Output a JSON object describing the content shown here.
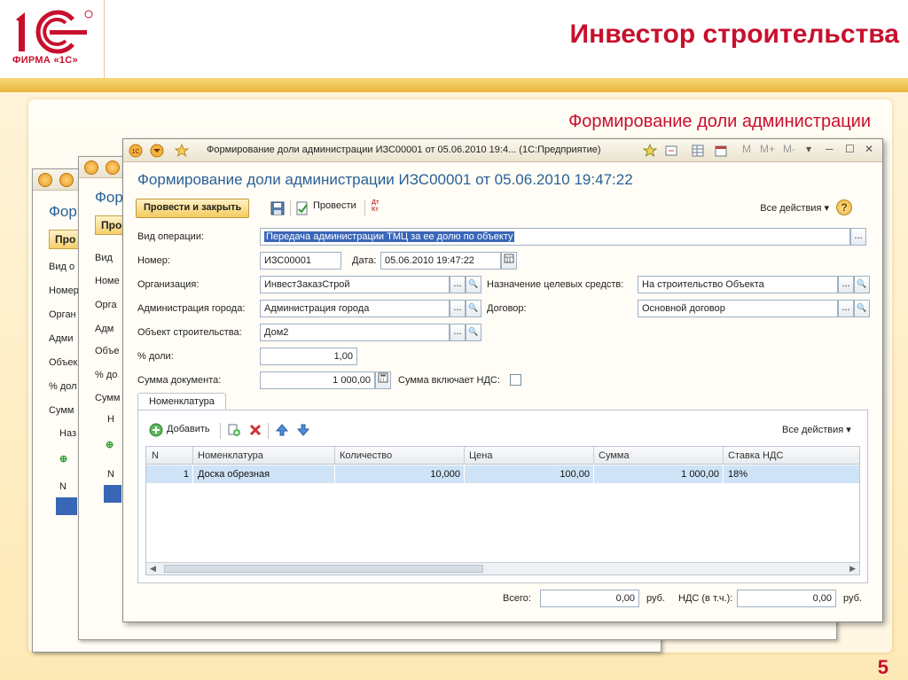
{
  "slide": {
    "title": "Инвестор строительства",
    "subtitle": "Формирование доли администрации",
    "page_number": "5",
    "logo_text": "ФИРМА «1С»",
    "logo_mark": "1С",
    "brand_color": "#c8102e"
  },
  "background_windows": [
    {
      "title_fragment": "Фор",
      "button_fragment": "Про",
      "labels": [
        "Вид о",
        "Номер",
        "Орган",
        "Адми",
        "Объек",
        "% дол",
        "Сумм"
      ],
      "tab_fragment": "Наз",
      "grid_header": "N"
    },
    {
      "title_fragment": "Фор",
      "button_fragment": "Про",
      "labels": [
        "Вид",
        "Номе",
        "Орга",
        "Адм",
        "Объе",
        "% до",
        "Сумм"
      ],
      "tab_fragment": "Н",
      "grid_header": "N"
    }
  ],
  "window": {
    "titlebar_text": "Формирование доли администрации ИЗС00001 от 05.06.2010 19:4...  (1С:Предприятие)",
    "titlebar_buttons": [
      "M",
      "M+",
      "M-",
      "▾",
      "─",
      "☐",
      "✕"
    ],
    "heading": "Формирование доли администрации ИЗС00001 от 05.06.2010 19:47:22"
  },
  "toolbar": {
    "post_and_close": "Провести и закрыть",
    "post": "Провести",
    "dt_kt": "Дт Кт",
    "all_actions": "Все действия ▾",
    "help": "?"
  },
  "form": {
    "operation_label": "Вид операции:",
    "operation_value": "Передача администрации ТМЦ за ее долю по объекту",
    "number_label": "Номер:",
    "number_value": "ИЗС00001",
    "date_label": "Дата:",
    "date_value": "05.06.2010 19:47:22",
    "org_label": "Организация:",
    "org_value": "ИнвестЗаказСтрой",
    "purpose_label": "Назначение целевых средств:",
    "purpose_value": "На строительство Объекта",
    "admin_label": "Администрация города:",
    "admin_value": "Администрация города",
    "contract_label": "Договор:",
    "contract_value": "Основной договор",
    "object_label": "Объект строительства:",
    "object_value": "Дом2",
    "share_label": "% доли:",
    "share_value": "1,00",
    "sum_label": "Сумма документа:",
    "sum_value": "1 000,00",
    "vat_included_label": "Сумма включает НДС:",
    "vat_included_checked": false,
    "ellipsis": "...",
    "search_glyph": "🔍"
  },
  "tabs": [
    {
      "label": "Номенклатура"
    }
  ],
  "items_toolbar": {
    "add": "Добавить",
    "all_actions": "Все действия ▾"
  },
  "grid": {
    "headers": [
      "N",
      "Номенклатура",
      "Количество",
      "Цена",
      "Сумма",
      "Ставка НДС"
    ],
    "rows": [
      [
        "1",
        "Доска обрезная",
        "10,000",
        "100,00",
        "1 000,00",
        "18%"
      ]
    ]
  },
  "footer": {
    "total_label": "Всего:",
    "total_value": "0,00",
    "total_unit": "руб.",
    "vat_label": "НДС (в т.ч.):",
    "vat_value": "0,00",
    "vat_unit": "руб."
  }
}
